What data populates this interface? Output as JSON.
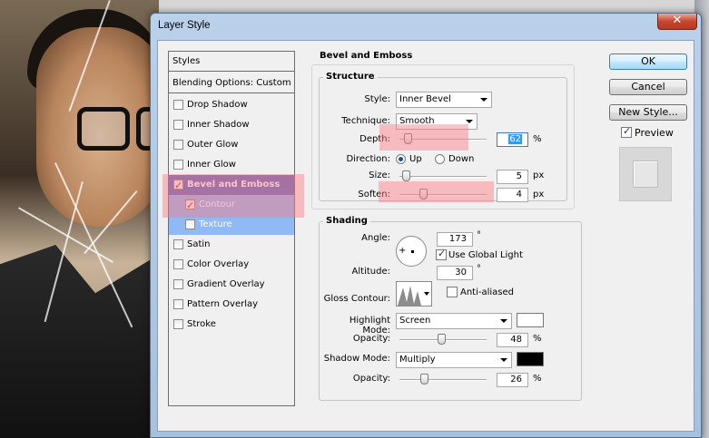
{
  "window": {
    "title": "Layer Style",
    "close_label": "✕"
  },
  "styles_list": {
    "header": "Styles",
    "blending": "Blending Options: Custom",
    "items": [
      {
        "label": "Drop Shadow",
        "checked": false
      },
      {
        "label": "Inner Shadow",
        "checked": false
      },
      {
        "label": "Outer Glow",
        "checked": false
      },
      {
        "label": "Inner Glow",
        "checked": false
      },
      {
        "label": "Bevel and Emboss",
        "checked": true,
        "selected": true
      },
      {
        "label": "Contour",
        "checked": true,
        "sub": true
      },
      {
        "label": "Texture",
        "checked": false,
        "sub": true
      },
      {
        "label": "Satin",
        "checked": false
      },
      {
        "label": "Color Overlay",
        "checked": false
      },
      {
        "label": "Gradient Overlay",
        "checked": false
      },
      {
        "label": "Pattern Overlay",
        "checked": false
      },
      {
        "label": "Stroke",
        "checked": false
      }
    ]
  },
  "bevel": {
    "section_title": "Bevel and Emboss",
    "structure_title": "Structure",
    "style_label": "Style:",
    "style_value": "Inner Bevel",
    "technique_label": "Technique:",
    "technique_value": "Smooth",
    "depth_label": "Depth:",
    "depth_value": "62",
    "depth_unit": "%",
    "depth_fraction": 0.06,
    "direction_label": "Direction:",
    "direction_up": "Up",
    "direction_down": "Down",
    "direction_selected": "Up",
    "size_label": "Size:",
    "size_value": "5",
    "size_unit": "px",
    "size_fraction": 0.03,
    "soften_label": "Soften:",
    "soften_value": "4",
    "soften_unit": "px",
    "soften_fraction": 0.25
  },
  "shading": {
    "title": "Shading",
    "angle_label": "Angle:",
    "angle_value": "173",
    "angle_unit": "°",
    "use_global_light": "Use Global Light",
    "use_global_light_checked": true,
    "altitude_label": "Altitude:",
    "altitude_value": "30",
    "altitude_unit": "°",
    "gloss_label": "Gloss Contour:",
    "anti_aliased": "Anti-aliased",
    "anti_aliased_checked": false,
    "highlight_label": "Highlight Mode:",
    "highlight_value": "Screen",
    "highlight_color": "#ffffff",
    "h_opacity_label": "Opacity:",
    "h_opacity_value": "48",
    "h_opacity_unit": "%",
    "h_opacity_fraction": 0.48,
    "shadow_label": "Shadow Mode:",
    "shadow_value": "Multiply",
    "shadow_color": "#000000",
    "s_opacity_label": "Opacity:",
    "s_opacity_value": "26",
    "s_opacity_unit": "%",
    "s_opacity_fraction": 0.26
  },
  "buttons": {
    "ok": "OK",
    "cancel": "Cancel",
    "new_style": "New Style...",
    "preview": "Preview",
    "preview_checked": true
  },
  "colors": {
    "selected_row": "#5b6ec0",
    "sub_row": "#8fbaf5",
    "highlight_overlay": "rgba(255,120,130,0.45)"
  }
}
